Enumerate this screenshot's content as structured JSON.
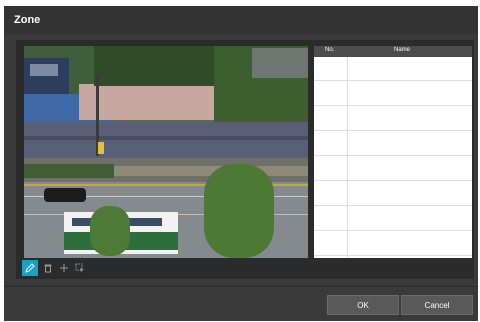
{
  "dialog": {
    "title": "Zone"
  },
  "toolbar": {
    "tools": [
      {
        "icon": "draw-zone-icon",
        "active": true
      },
      {
        "icon": "delete-icon",
        "active": false
      },
      {
        "icon": "move-icon",
        "active": false
      },
      {
        "icon": "select-icon",
        "active": false
      }
    ]
  },
  "zone_table": {
    "columns": {
      "no": "No.",
      "name": "Name"
    },
    "rows": [
      {
        "no": "",
        "name": ""
      },
      {
        "no": "",
        "name": ""
      },
      {
        "no": "",
        "name": ""
      },
      {
        "no": "",
        "name": ""
      },
      {
        "no": "",
        "name": ""
      },
      {
        "no": "",
        "name": ""
      },
      {
        "no": "",
        "name": ""
      },
      {
        "no": "",
        "name": ""
      }
    ]
  },
  "buttons": {
    "ok": "OK",
    "cancel": "Cancel"
  },
  "colors": {
    "accent": "#17a1c7",
    "dialog_bg": "#3a3a3a",
    "panel_bg": "#2b2b2b"
  }
}
